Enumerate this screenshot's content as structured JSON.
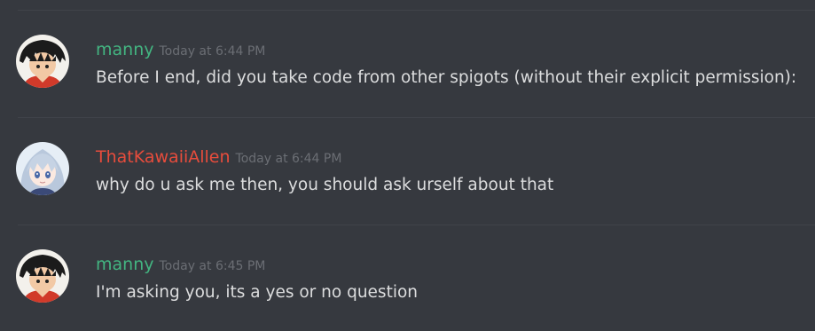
{
  "messages": [
    {
      "author": "manny",
      "author_color": "#43b581",
      "timestamp": "Today at 6:44 PM",
      "text": "Before I end, did you take code from other spigots (without their explicit permission):",
      "avatar": "manny-avatar"
    },
    {
      "author": "ThatKawaiiAllen",
      "author_color": "#e74c3c",
      "timestamp": "Today at 6:44 PM",
      "text": "why do u ask me then, you should ask urself about that",
      "avatar": "thatkawaiiallen-avatar"
    },
    {
      "author": "manny",
      "author_color": "#43b581",
      "timestamp": "Today at 6:45 PM",
      "text": "I'm asking you, its a yes or no question",
      "avatar": "manny-avatar"
    }
  ]
}
